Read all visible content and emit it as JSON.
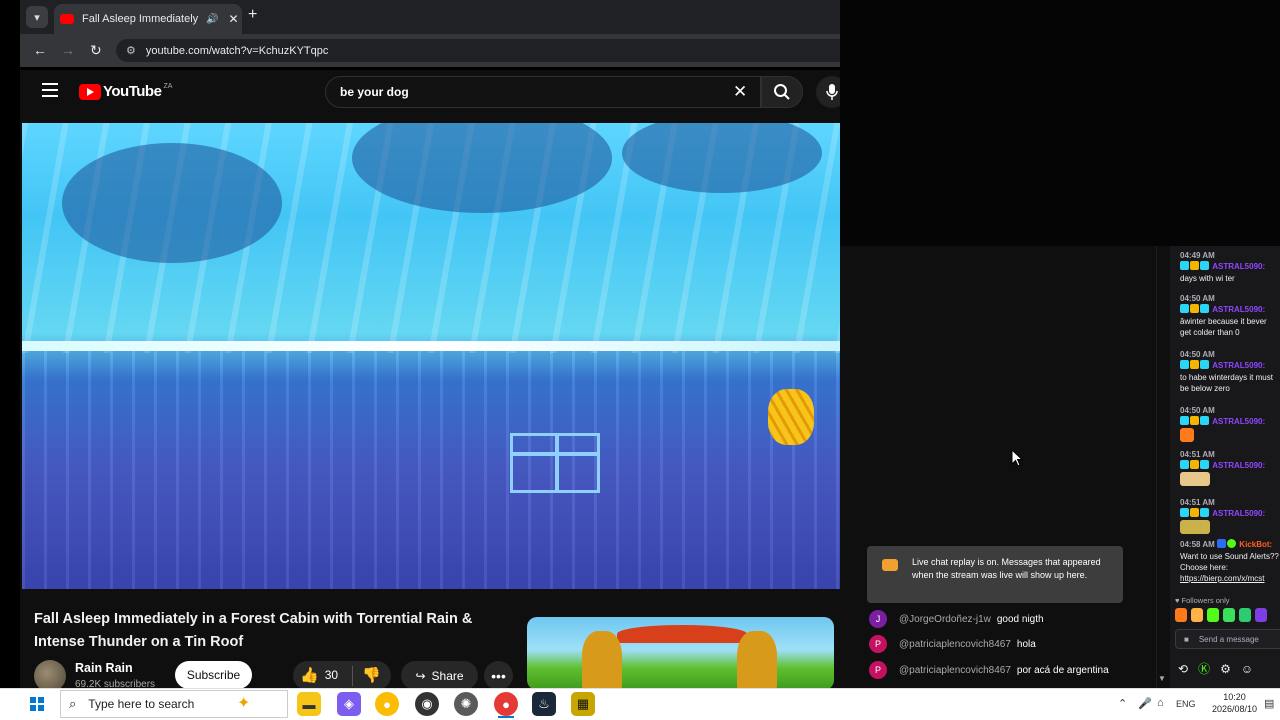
{
  "browser": {
    "tab_title": "Fall Asleep Immediately in a",
    "tab_dropdown_icon": "chevron-down-icon",
    "new_tab_label": "+",
    "url": "youtube.com/watch?v=KchuzKYTqpc"
  },
  "youtube": {
    "logo_text": "YouTube",
    "country_code": "ZA",
    "search_value": "be your dog",
    "video": {
      "title": "Fall Asleep Immediately in a Forest Cabin with Torrential Rain & Intense Thunder on a Tin Roof",
      "channel_name": "Rain Rain",
      "subscribers": "69.2K subscribers",
      "subscribe_label": "Subscribe",
      "like_count": "30",
      "share_label": "Share",
      "more_label": "•••"
    },
    "live_chat": {
      "replay_notice": "Live chat replay is on. Messages that appeared when the stream was live will show up here.",
      "messages": [
        {
          "initial": "J",
          "avatar_color": "#7b1fa2",
          "author": "@JorgeOrdoñez-j1w",
          "text": "good nigth"
        },
        {
          "initial": "P",
          "avatar_color": "#c51162",
          "author": "@patriciaplencovich8467",
          "text": "hola"
        },
        {
          "initial": "P",
          "avatar_color": "#c51162",
          "author": "@patriciaplencovich8467",
          "text": "por acá de argentina"
        }
      ]
    }
  },
  "stream_chat": {
    "messages": [
      {
        "time": "04:49 AM",
        "user": "ASTRAL5090:",
        "text": "days with wi ter"
      },
      {
        "time": "04:50 AM",
        "user": "ASTRAL5090:",
        "text": "âwinter because it bever get colder than 0"
      },
      {
        "time": "04:50 AM",
        "user": "ASTRAL5090:",
        "text": "to habe winterdays it must be below zero"
      },
      {
        "time": "04:50 AM",
        "user": "ASTRAL5090:",
        "text": ""
      },
      {
        "time": "04:51 AM",
        "user": "ASTRAL5090:",
        "text": ""
      },
      {
        "time": "04:51 AM",
        "user": "ASTRAL5090:",
        "text": ""
      },
      {
        "time": "04:58 AM",
        "user": "KickBot:",
        "text": "Want to use Sound Alerts?? Choose here:",
        "link": "https://bierp.com/x/mcst"
      }
    ],
    "followers_only": "Followers only",
    "send_placeholder": "Send a message"
  },
  "taskbar": {
    "search_placeholder": "Type here to search",
    "language": "ENG",
    "time": "10:20",
    "date": "2026/08/10"
  },
  "colors": {
    "youtube_red": "#ff0000",
    "kick_green": "#53fc18",
    "twitch_purple": "#9147ff"
  }
}
